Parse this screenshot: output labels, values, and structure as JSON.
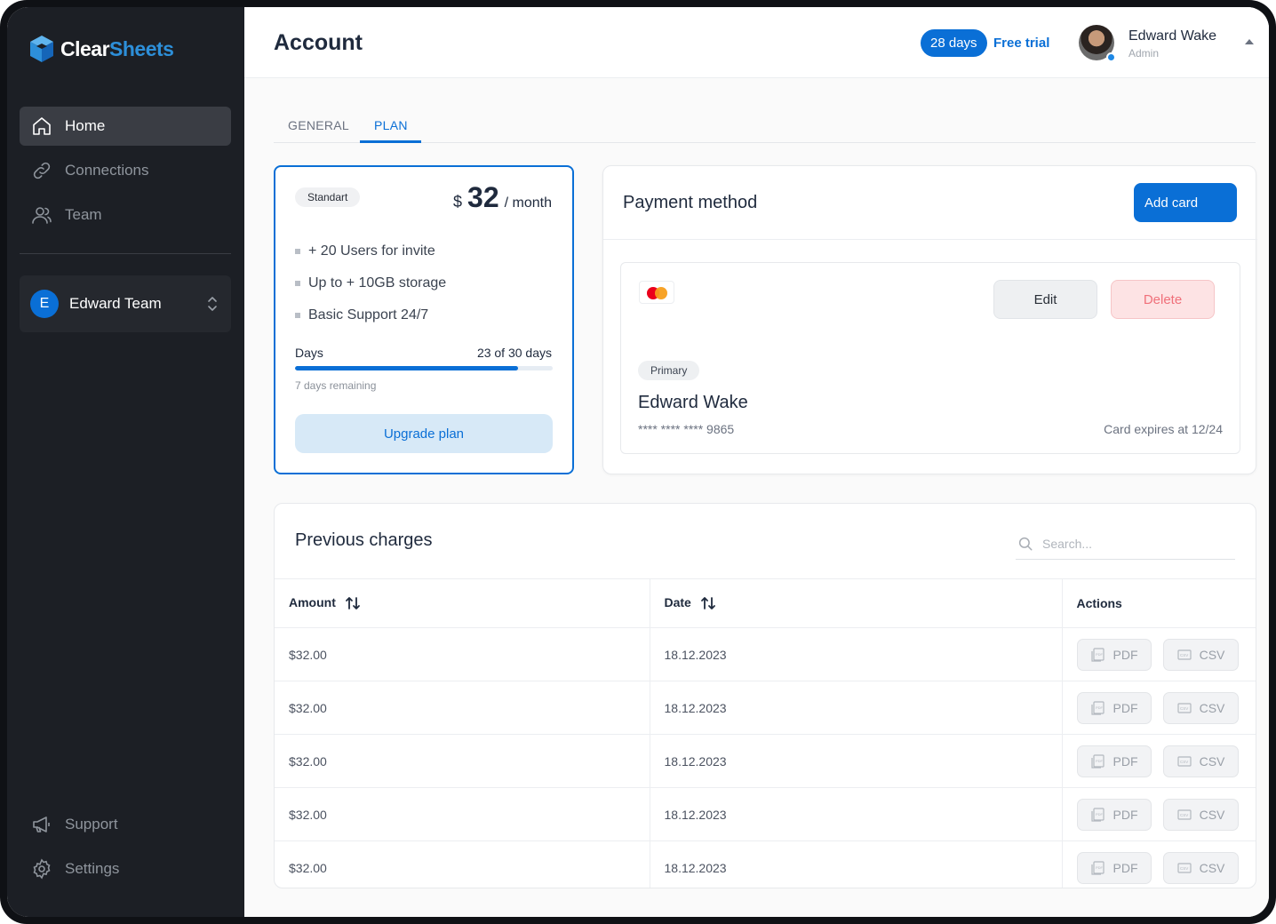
{
  "app": {
    "brand_part1": "Clear",
    "brand_part2": "Sheets",
    "brand_color": "#2d8fd9"
  },
  "sidebar": {
    "items": [
      {
        "label": "Home",
        "icon": "home-icon",
        "active": true
      },
      {
        "label": "Connections",
        "icon": "link-icon",
        "active": false
      },
      {
        "label": "Team",
        "icon": "users-icon",
        "active": false
      }
    ],
    "team": {
      "initial": "E",
      "name": "Edward Team"
    },
    "bottom_items": [
      {
        "label": "Support",
        "icon": "megaphone-icon"
      },
      {
        "label": "Settings",
        "icon": "gear-icon"
      }
    ]
  },
  "header": {
    "title": "Account",
    "trial_days": "28 days",
    "trial_label": "Free trial",
    "user_name": "Edward Wake",
    "user_role": "Admin"
  },
  "tabs": [
    {
      "label": "GENERAL",
      "active": false
    },
    {
      "label": "PLAN",
      "active": true
    }
  ],
  "plan": {
    "tier": "Standart",
    "currency": "$",
    "price": "32",
    "period": "/ month",
    "features": [
      "+ 20 Users for invite",
      "Up to + 10GB storage",
      "Basic Support 24/7"
    ],
    "days_label": "Days",
    "days_value": "23 of 30 days",
    "progress": 0.866,
    "remaining": "7 days remaining",
    "upgrade_label": "Upgrade plan"
  },
  "payment": {
    "title": "Payment method",
    "add_card_label": "Add card",
    "card": {
      "brand_icon": "mastercard-icon",
      "edit_label": "Edit",
      "delete_label": "Delete",
      "badge": "Primary",
      "holder": "Edward Wake",
      "number": "**** **** **** 9865",
      "expires": "Card expires at 12/24"
    }
  },
  "charges": {
    "title": "Previous charges",
    "search_placeholder": "Search...",
    "columns": [
      "Amount",
      "Date",
      "Actions"
    ],
    "rows": [
      {
        "amount": "$32.00",
        "date": "18.12.2023"
      },
      {
        "amount": "$32.00",
        "date": "18.12.2023"
      },
      {
        "amount": "$32.00",
        "date": "18.12.2023"
      },
      {
        "amount": "$32.00",
        "date": "18.12.2023"
      },
      {
        "amount": "$32.00",
        "date": "18.12.2023"
      }
    ],
    "pdf_label": "PDF",
    "csv_label": "CSV"
  }
}
